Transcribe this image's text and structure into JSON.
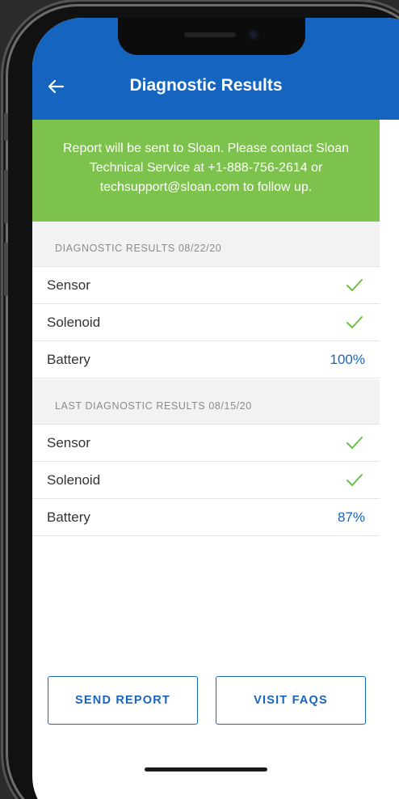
{
  "header": {
    "title": "Diagnostic Results",
    "back_icon": "back-arrow-icon",
    "color": "#1565c0"
  },
  "banner": {
    "message": "Report will be sent to Sloan. Please contact Sloan Technical Service at +1-888-756-2614 or techsupport@sloan.com to follow up.",
    "color": "#7cc24c"
  },
  "current_results": {
    "heading": "DIAGNOSTIC RESULTS 08/22/20",
    "rows": [
      {
        "label": "Sensor",
        "status": "check-icon"
      },
      {
        "label": "Solenoid",
        "status": "check-icon"
      },
      {
        "label": "Battery",
        "value": "100%"
      }
    ]
  },
  "last_results": {
    "heading": "LAST DIAGNOSTIC RESULTS 08/15/20",
    "rows": [
      {
        "label": "Sensor",
        "status": "check-icon"
      },
      {
        "label": "Solenoid",
        "status": "check-icon"
      },
      {
        "label": "Battery",
        "value": "87%"
      }
    ]
  },
  "actions": {
    "send_report_label": "SEND REPORT",
    "visit_faqs_label": "VISIT FAQS"
  },
  "colors": {
    "accent": "#1565c0",
    "success": "#6cbf45"
  }
}
